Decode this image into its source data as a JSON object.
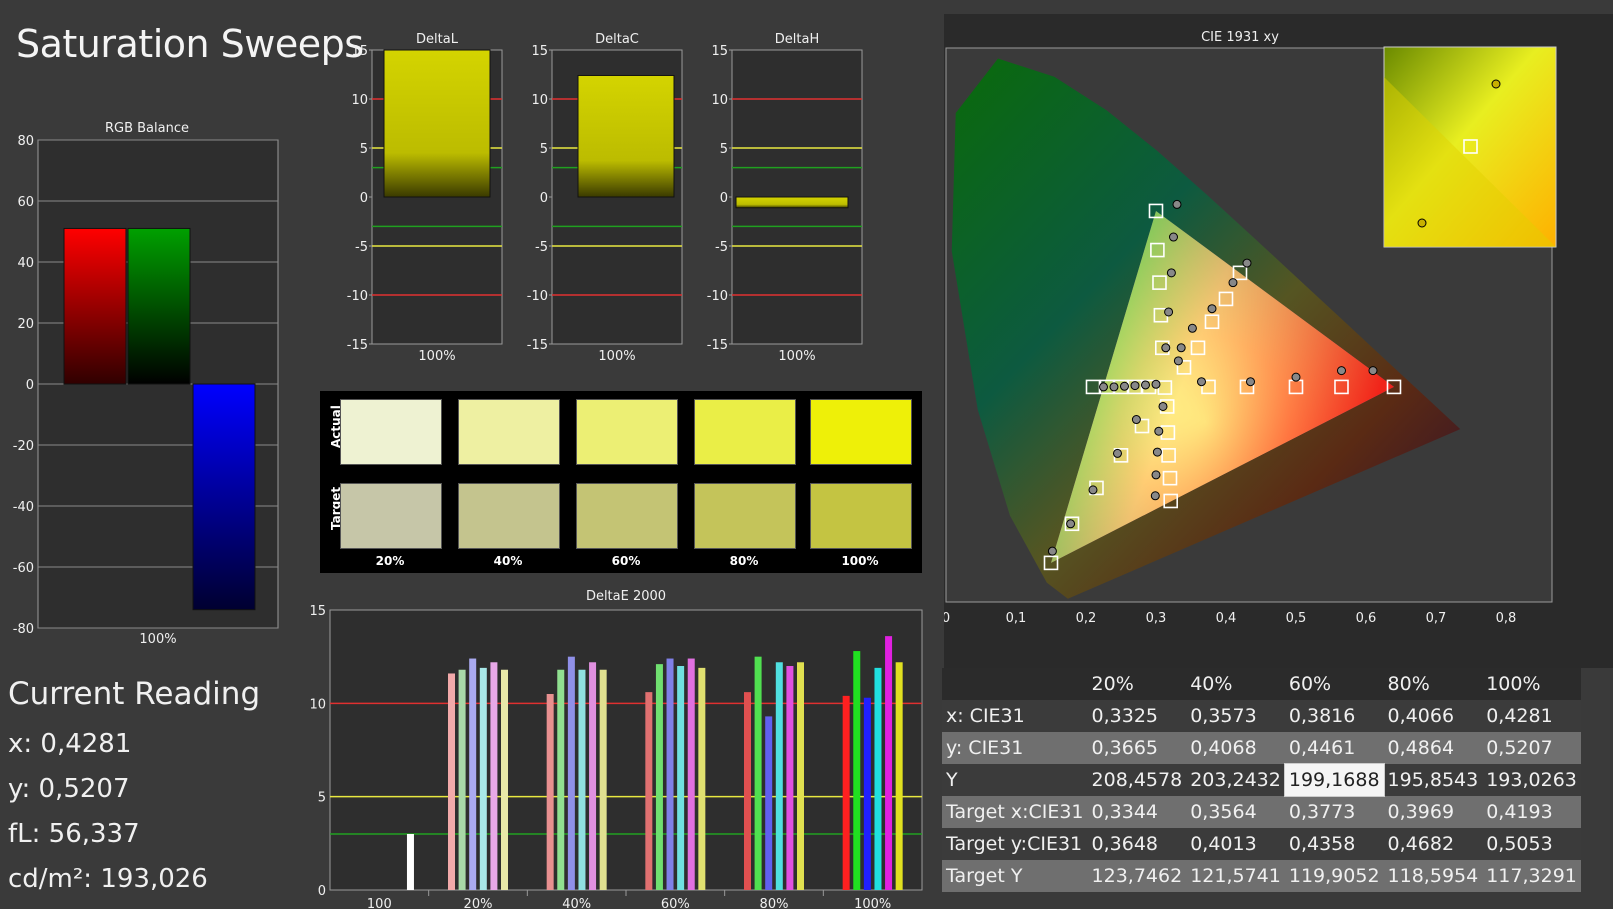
{
  "title": "Saturation Sweeps",
  "current_reading": {
    "heading": "Current Reading",
    "x": "x: 0,4281",
    "y": "y: 0,5207",
    "fl": "fL: 56,337",
    "cdm2": "cd/m²: 193,026"
  },
  "swatches": {
    "actual_label": "Actual",
    "target_label": "Target",
    "labels": [
      "20%",
      "40%",
      "60%",
      "80%",
      "100%"
    ],
    "actual_colors": [
      "#eef2d2",
      "#eef0a2",
      "#ecef74",
      "#eaee47",
      "#eef008"
    ],
    "target_colors": [
      "#c6c6a8",
      "#c4c48e",
      "#c4c474",
      "#c4c45a",
      "#c4c442"
    ]
  },
  "table": {
    "headers": [
      "",
      "20%",
      "40%",
      "60%",
      "80%",
      "100%"
    ],
    "rows": [
      {
        "label": "x: CIE31",
        "values": [
          "0,3325",
          "0,3573",
          "0,3816",
          "0,4066",
          "0,4281"
        ]
      },
      {
        "label": "y: CIE31",
        "values": [
          "0,3665",
          "0,4068",
          "0,4461",
          "0,4864",
          "0,5207"
        ]
      },
      {
        "label": "Y",
        "values": [
          "208,4578",
          "203,2432",
          "199,1688",
          "195,8543",
          "193,0263"
        ]
      },
      {
        "label": "Target x:CIE31",
        "values": [
          "0,3344",
          "0,3564",
          "0,3773",
          "0,3969",
          "0,4193"
        ]
      },
      {
        "label": "Target y:CIE31",
        "values": [
          "0,3648",
          "0,4013",
          "0,4358",
          "0,4682",
          "0,5053"
        ]
      },
      {
        "label": "Target Y",
        "values": [
          "123,7462",
          "121,5741",
          "119,9052",
          "118,5954",
          "117,3291"
        ]
      }
    ]
  },
  "chart_data": [
    {
      "type": "bar",
      "title": "RGB Balance",
      "categories": [
        "100%"
      ],
      "series": [
        {
          "color": "#ff0000",
          "values": [
            51
          ]
        },
        {
          "color": "#00a000",
          "values": [
            51
          ]
        },
        {
          "color": "#0000ff",
          "values": [
            -74
          ]
        }
      ],
      "ylim": [
        -80,
        80
      ],
      "yticks": [
        80,
        60,
        40,
        20,
        0,
        -20,
        -40,
        -60,
        -80
      ]
    },
    {
      "type": "bar",
      "title": "DeltaL",
      "categories": [
        "100%"
      ],
      "values": [
        15
      ],
      "ylim": [
        -15,
        15
      ],
      "yticks": [
        15,
        10,
        5,
        0,
        -5,
        -10,
        -15
      ],
      "color": "#c8c800"
    },
    {
      "type": "bar",
      "title": "DeltaC",
      "categories": [
        "100%"
      ],
      "values": [
        12.4
      ],
      "ylim": [
        -15,
        15
      ],
      "yticks": [
        15,
        10,
        5,
        0,
        -5,
        -10,
        -15
      ],
      "color": "#c8c800"
    },
    {
      "type": "bar",
      "title": "DeltaH",
      "categories": [
        "100%"
      ],
      "values": [
        -1.1
      ],
      "ylim": [
        -15,
        15
      ],
      "yticks": [
        15,
        10,
        5,
        0,
        -5,
        -10,
        -15
      ],
      "color": "#c8c800"
    },
    {
      "type": "bar",
      "title": "DeltaE 2000",
      "categories": [
        "100",
        "20%",
        "40%",
        "60%",
        "80%",
        "100%"
      ],
      "groups": [
        {
          "values": [
            3.0
          ],
          "colors": [
            "#ffffff"
          ]
        },
        {
          "values": [
            11.6,
            11.8,
            12.4,
            11.9,
            12.2,
            11.8
          ],
          "colors": [
            "#f2aaaa",
            "#a8d8a8",
            "#aaaaf0",
            "#a8e8e8",
            "#e8a8e8",
            "#e8e8a8"
          ]
        },
        {
          "values": [
            10.5,
            11.8,
            12.5,
            11.8,
            12.2,
            11.8
          ],
          "colors": [
            "#e89090",
            "#90e090",
            "#9090e8",
            "#90e0e0",
            "#e090e0",
            "#e0e090"
          ]
        },
        {
          "values": [
            10.6,
            12.1,
            12.4,
            12.0,
            12.4,
            11.9
          ],
          "colors": [
            "#e07070",
            "#70e070",
            "#8080e8",
            "#70e0e0",
            "#e070e0",
            "#e0e070"
          ]
        },
        {
          "values": [
            10.6,
            12.5,
            9.3,
            12.2,
            12.0,
            12.2
          ],
          "colors": [
            "#e05050",
            "#50e050",
            "#6060f0",
            "#50e0e0",
            "#e050e0",
            "#e0e050"
          ]
        },
        {
          "values": [
            10.4,
            12.8,
            10.3,
            11.9,
            13.6,
            12.2
          ],
          "colors": [
            "#ff2020",
            "#20e020",
            "#2020ff",
            "#20e0e0",
            "#e020e0",
            "#e0e020"
          ]
        }
      ],
      "ylim": [
        0,
        15
      ],
      "yticks": [
        15,
        10,
        5,
        0
      ]
    },
    {
      "type": "scatter",
      "title": "CIE 1931 xy",
      "xlim": [
        0,
        0.8
      ],
      "ylim": [
        0,
        0.85
      ],
      "xticks": [
        "0",
        "0,1",
        "0,2",
        "0,3",
        "0,4",
        "0,5",
        "0,6",
        "0,7",
        "0,8"
      ],
      "yticks": [
        "0",
        "0,1",
        "0,2",
        "0,3",
        "0,4",
        "0,5",
        "0,6",
        "0,7",
        "0,8"
      ],
      "targets": [
        [
          0.3127,
          0.329
        ],
        [
          0.3,
          0.6
        ],
        [
          0.302,
          0.54
        ],
        [
          0.305,
          0.49
        ],
        [
          0.307,
          0.44
        ],
        [
          0.309,
          0.39
        ],
        [
          0.64,
          0.33
        ],
        [
          0.565,
          0.33
        ],
        [
          0.5,
          0.33
        ],
        [
          0.43,
          0.33
        ],
        [
          0.375,
          0.33
        ],
        [
          0.15,
          0.06
        ],
        [
          0.18,
          0.12
        ],
        [
          0.215,
          0.175
        ],
        [
          0.25,
          0.225
        ],
        [
          0.28,
          0.27
        ],
        [
          0.321,
          0.155
        ],
        [
          0.32,
          0.19
        ],
        [
          0.318,
          0.225
        ],
        [
          0.317,
          0.26
        ],
        [
          0.316,
          0.3
        ],
        [
          0.42,
          0.505
        ],
        [
          0.4,
          0.465
        ],
        [
          0.38,
          0.43
        ],
        [
          0.36,
          0.39
        ],
        [
          0.34,
          0.36
        ],
        [
          0.21,
          0.33
        ],
        [
          0.23,
          0.33
        ],
        [
          0.25,
          0.33
        ],
        [
          0.27,
          0.33
        ],
        [
          0.29,
          0.33
        ]
      ],
      "measured": [
        [
          0.33,
          0.61
        ],
        [
          0.325,
          0.56
        ],
        [
          0.322,
          0.505
        ],
        [
          0.318,
          0.445
        ],
        [
          0.314,
          0.39
        ],
        [
          0.332,
          0.37
        ],
        [
          0.61,
          0.355
        ],
        [
          0.565,
          0.355
        ],
        [
          0.5,
          0.345
        ],
        [
          0.435,
          0.338
        ],
        [
          0.365,
          0.338
        ],
        [
          0.152,
          0.078
        ],
        [
          0.178,
          0.12
        ],
        [
          0.21,
          0.172
        ],
        [
          0.245,
          0.228
        ],
        [
          0.272,
          0.28
        ],
        [
          0.299,
          0.163
        ],
        [
          0.3,
          0.195
        ],
        [
          0.302,
          0.23
        ],
        [
          0.304,
          0.262
        ],
        [
          0.31,
          0.3
        ],
        [
          0.43,
          0.52
        ],
        [
          0.41,
          0.49
        ],
        [
          0.38,
          0.45
        ],
        [
          0.352,
          0.42
        ],
        [
          0.336,
          0.39
        ],
        [
          0.225,
          0.33
        ],
        [
          0.24,
          0.33
        ],
        [
          0.255,
          0.331
        ],
        [
          0.27,
          0.332
        ],
        [
          0.285,
          0.333
        ],
        [
          0.3,
          0.334
        ]
      ]
    }
  ]
}
